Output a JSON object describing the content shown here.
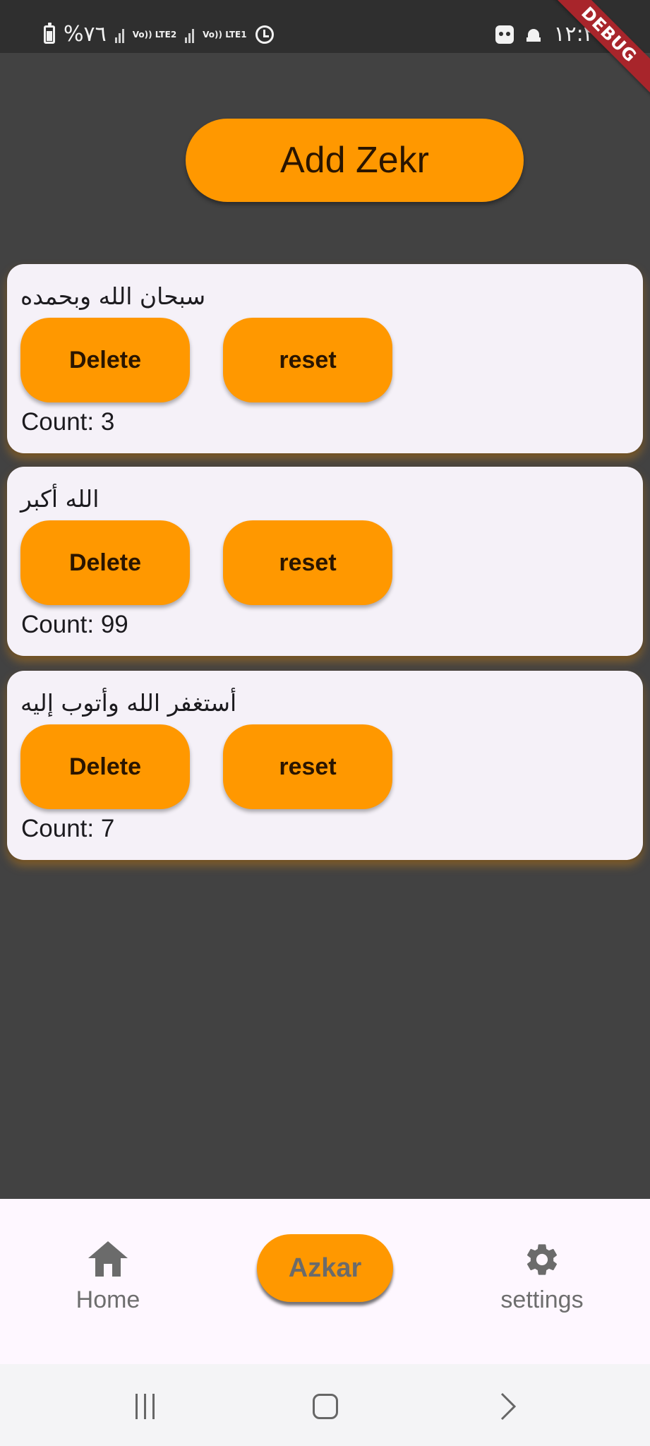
{
  "status_bar": {
    "battery_text": "%٧٦",
    "signal_labels": [
      "Vo)) LTE2",
      "Vo)) LTE1"
    ],
    "time": "١٢:٢٧",
    "icons": [
      "battery-icon",
      "signal-icon",
      "alarm-icon",
      "robot-icon",
      "mosque-icon"
    ]
  },
  "debug_banner": "DEBUG",
  "header": {
    "add_button_label": "Add Zekr"
  },
  "azkar": [
    {
      "text": "سبحان الله وبحمده",
      "delete_label": "Delete",
      "reset_label": "reset",
      "count_text": "Count: 3"
    },
    {
      "text": "الله أكبر",
      "delete_label": "Delete",
      "reset_label": "reset",
      "count_text": "Count: 99"
    },
    {
      "text": "أستغفر الله وأتوب إليه",
      "delete_label": "Delete",
      "reset_label": "reset",
      "count_text": "Count: 7"
    }
  ],
  "bottom_nav": {
    "home_label": "Home",
    "azkar_label": "Azkar",
    "settings_label": "settings",
    "selected": "Azkar"
  },
  "colors": {
    "accent": "#ff9800",
    "background": "#424242",
    "card": "#f5f1f8",
    "nav_background": "#fef7ff"
  }
}
